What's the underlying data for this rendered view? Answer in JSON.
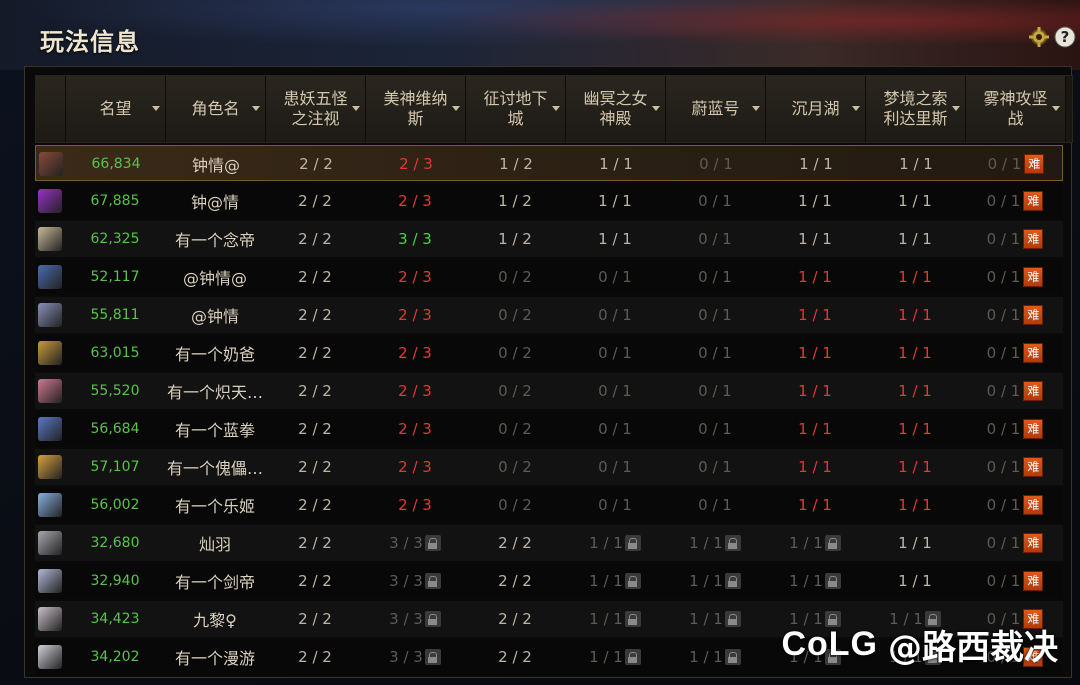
{
  "title": "玩法信息",
  "icons": {
    "settings": "gear-icon",
    "help": "question-icon"
  },
  "columns": [
    {
      "label": "",
      "w": 30
    },
    {
      "label": "名望",
      "w": 100
    },
    {
      "label": "角色名",
      "w": 100
    },
    {
      "label": "患妖五怪之注视",
      "w": 100
    },
    {
      "label": "美神维纳斯",
      "w": 100
    },
    {
      "label": "征讨地下城",
      "w": 100
    },
    {
      "label": "幽冥之女神殿",
      "w": 100
    },
    {
      "label": "蔚蓝号",
      "w": 100
    },
    {
      "label": "沉月湖",
      "w": 100
    },
    {
      "label": "梦境之索利达里斯",
      "w": 100
    },
    {
      "label": "雾神攻坚战",
      "w": 100
    }
  ],
  "hard_label": "难",
  "rows": [
    {
      "avatar": "#8a4a3a",
      "fame": "66,834",
      "name": "钟情@",
      "c": [
        [
          "2 / 2",
          ""
        ],
        [
          "2 / 3",
          "red"
        ],
        [
          "1 / 2",
          ""
        ],
        [
          "1 / 1",
          ""
        ],
        [
          "0 / 1",
          "dim"
        ],
        [
          "1 / 1",
          ""
        ],
        [
          "1 / 1",
          ""
        ],
        [
          "0 / 1",
          "dim"
        ]
      ],
      "locks": [
        0,
        0,
        0,
        0,
        0,
        0,
        0,
        0
      ],
      "selected": true
    },
    {
      "avatar": "#9a30c8",
      "fame": "67,885",
      "name": "钟@情",
      "c": [
        [
          "2 / 2",
          ""
        ],
        [
          "2 / 3",
          "red"
        ],
        [
          "1 / 2",
          ""
        ],
        [
          "1 / 1",
          ""
        ],
        [
          "0 / 1",
          "dim"
        ],
        [
          "1 / 1",
          ""
        ],
        [
          "1 / 1",
          ""
        ],
        [
          "0 / 1",
          "dim"
        ]
      ],
      "locks": [
        0,
        0,
        0,
        0,
        0,
        0,
        0,
        0
      ]
    },
    {
      "avatar": "#c8b898",
      "fame": "62,325",
      "name": "有一个念帝",
      "c": [
        [
          "2 / 2",
          ""
        ],
        [
          "3 / 3",
          "green"
        ],
        [
          "1 / 2",
          ""
        ],
        [
          "1 / 1",
          ""
        ],
        [
          "0 / 1",
          "dim"
        ],
        [
          "1 / 1",
          ""
        ],
        [
          "1 / 1",
          ""
        ],
        [
          "0 / 1",
          "dim"
        ]
      ],
      "locks": [
        0,
        0,
        0,
        0,
        0,
        0,
        0,
        0
      ]
    },
    {
      "avatar": "#4a6ab0",
      "fame": "52,117",
      "name": "@钟情@",
      "c": [
        [
          "2 / 2",
          ""
        ],
        [
          "2 / 3",
          "red"
        ],
        [
          "0 / 2",
          "dim"
        ],
        [
          "0 / 1",
          "dim"
        ],
        [
          "0 / 1",
          "dim"
        ],
        [
          "1 / 1",
          "red"
        ],
        [
          "1 / 1",
          "red"
        ],
        [
          "0 / 1",
          "dim"
        ]
      ],
      "locks": [
        0,
        0,
        0,
        0,
        0,
        0,
        0,
        0
      ]
    },
    {
      "avatar": "#8a90b8",
      "fame": "55,811",
      "name": "@钟情",
      "c": [
        [
          "2 / 2",
          ""
        ],
        [
          "2 / 3",
          "red"
        ],
        [
          "0 / 2",
          "dim"
        ],
        [
          "0 / 1",
          "dim"
        ],
        [
          "0 / 1",
          "dim"
        ],
        [
          "1 / 1",
          "red"
        ],
        [
          "1 / 1",
          "red"
        ],
        [
          "0 / 1",
          "dim"
        ]
      ],
      "locks": [
        0,
        0,
        0,
        0,
        0,
        0,
        0,
        0
      ]
    },
    {
      "avatar": "#c89a3a",
      "fame": "63,015",
      "name": "有一个奶爸",
      "c": [
        [
          "2 / 2",
          ""
        ],
        [
          "2 / 3",
          "red"
        ],
        [
          "0 / 2",
          "dim"
        ],
        [
          "0 / 1",
          "dim"
        ],
        [
          "0 / 1",
          "dim"
        ],
        [
          "1 / 1",
          "red"
        ],
        [
          "1 / 1",
          "red"
        ],
        [
          "0 / 1",
          "dim"
        ]
      ],
      "locks": [
        0,
        0,
        0,
        0,
        0,
        0,
        0,
        0
      ]
    },
    {
      "avatar": "#d07890",
      "fame": "55,520",
      "name": "有一个炽天…",
      "c": [
        [
          "2 / 2",
          ""
        ],
        [
          "2 / 3",
          "red"
        ],
        [
          "0 / 2",
          "dim"
        ],
        [
          "0 / 1",
          "dim"
        ],
        [
          "0 / 1",
          "dim"
        ],
        [
          "1 / 1",
          "red"
        ],
        [
          "1 / 1",
          "red"
        ],
        [
          "0 / 1",
          "dim"
        ]
      ],
      "locks": [
        0,
        0,
        0,
        0,
        0,
        0,
        0,
        0
      ]
    },
    {
      "avatar": "#5a78c8",
      "fame": "56,684",
      "name": "有一个蓝拳",
      "c": [
        [
          "2 / 2",
          ""
        ],
        [
          "2 / 3",
          "red"
        ],
        [
          "0 / 2",
          "dim"
        ],
        [
          "0 / 1",
          "dim"
        ],
        [
          "0 / 1",
          "dim"
        ],
        [
          "1 / 1",
          "red"
        ],
        [
          "1 / 1",
          "red"
        ],
        [
          "0 / 1",
          "dim"
        ]
      ],
      "locks": [
        0,
        0,
        0,
        0,
        0,
        0,
        0,
        0
      ]
    },
    {
      "avatar": "#d8a040",
      "fame": "57,107",
      "name": "有一个傀儡…",
      "c": [
        [
          "2 / 2",
          ""
        ],
        [
          "2 / 3",
          "red"
        ],
        [
          "0 / 2",
          "dim"
        ],
        [
          "0 / 1",
          "dim"
        ],
        [
          "0 / 1",
          "dim"
        ],
        [
          "1 / 1",
          "red"
        ],
        [
          "1 / 1",
          "red"
        ],
        [
          "0 / 1",
          "dim"
        ]
      ],
      "locks": [
        0,
        0,
        0,
        0,
        0,
        0,
        0,
        0
      ]
    },
    {
      "avatar": "#88b0e0",
      "fame": "56,002",
      "name": "有一个乐姬",
      "c": [
        [
          "2 / 2",
          ""
        ],
        [
          "2 / 3",
          "red"
        ],
        [
          "0 / 2",
          "dim"
        ],
        [
          "0 / 1",
          "dim"
        ],
        [
          "0 / 1",
          "dim"
        ],
        [
          "1 / 1",
          "red"
        ],
        [
          "1 / 1",
          "red"
        ],
        [
          "0 / 1",
          "dim"
        ]
      ],
      "locks": [
        0,
        0,
        0,
        0,
        0,
        0,
        0,
        0
      ]
    },
    {
      "avatar": "#a8a8b0",
      "fame": "32,680",
      "name": "灿羽",
      "c": [
        [
          "2 / 2",
          ""
        ],
        [
          "3 / 3",
          "dim"
        ],
        [
          "2 / 2",
          ""
        ],
        [
          "1 / 1",
          "dim"
        ],
        [
          "1 / 1",
          "dim"
        ],
        [
          "1 / 1",
          "dim"
        ],
        [
          "1 / 1",
          ""
        ],
        [
          "0 / 1",
          "dim"
        ]
      ],
      "locks": [
        0,
        1,
        0,
        1,
        1,
        1,
        0,
        0
      ]
    },
    {
      "avatar": "#b0b8d8",
      "fame": "32,940",
      "name": "有一个剑帝",
      "c": [
        [
          "2 / 2",
          ""
        ],
        [
          "3 / 3",
          "dim"
        ],
        [
          "2 / 2",
          ""
        ],
        [
          "1 / 1",
          "dim"
        ],
        [
          "1 / 1",
          "dim"
        ],
        [
          "1 / 1",
          "dim"
        ],
        [
          "1 / 1",
          ""
        ],
        [
          "0 / 1",
          "dim"
        ]
      ],
      "locks": [
        0,
        1,
        0,
        1,
        1,
        1,
        0,
        0
      ]
    },
    {
      "avatar": "#c8c0c8",
      "fame": "34,423",
      "name": "九黎♀",
      "c": [
        [
          "2 / 2",
          ""
        ],
        [
          "3 / 3",
          "dim"
        ],
        [
          "2 / 2",
          ""
        ],
        [
          "1 / 1",
          "dim"
        ],
        [
          "1 / 1",
          "dim"
        ],
        [
          "1 / 1",
          "dim"
        ],
        [
          "1 / 1",
          "dim"
        ],
        [
          "0 / 1",
          "dim"
        ]
      ],
      "locks": [
        0,
        1,
        0,
        1,
        1,
        1,
        1,
        0
      ]
    },
    {
      "avatar": "#d0d0d8",
      "fame": "34,202",
      "name": "有一个漫游",
      "c": [
        [
          "2 / 2",
          ""
        ],
        [
          "3 / 3",
          "dim"
        ],
        [
          "2 / 2",
          ""
        ],
        [
          "1 / 1",
          "dim"
        ],
        [
          "1 / 1",
          "dim"
        ],
        [
          "1 / 1",
          "dim"
        ],
        [
          "1 / 1",
          "dim"
        ],
        [
          "0 / 1",
          "dim"
        ]
      ],
      "locks": [
        0,
        1,
        0,
        1,
        1,
        1,
        1,
        0
      ]
    }
  ],
  "watermark": {
    "logo": "CoLG",
    "text": "@路西裁决"
  }
}
